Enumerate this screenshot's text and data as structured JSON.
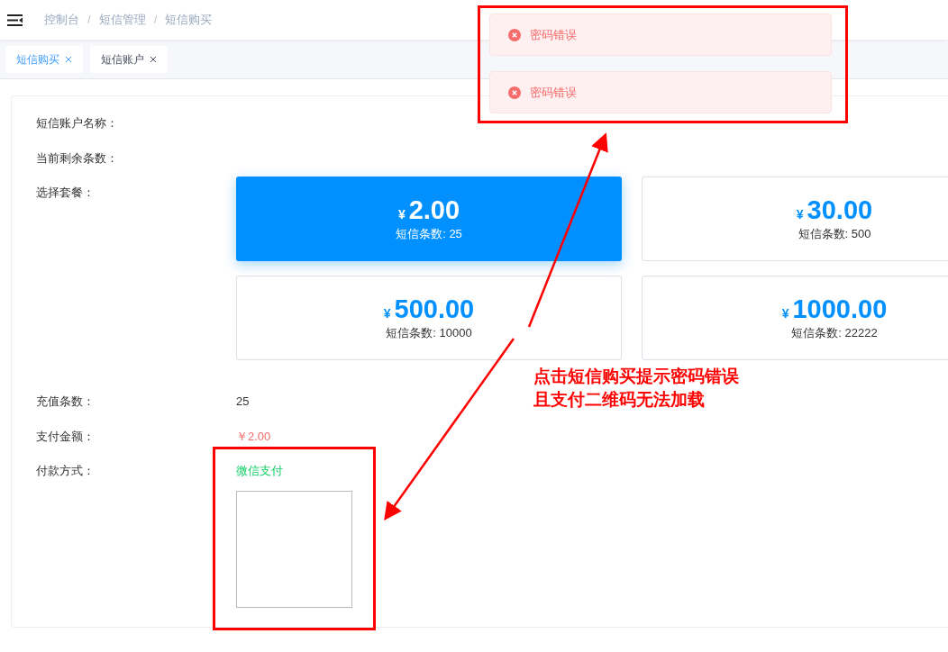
{
  "breadcrumb": [
    "控制台",
    "短信管理",
    "短信购买"
  ],
  "breadcrumb_separator": "/",
  "tabs": [
    {
      "label": "短信购买",
      "selected": true
    },
    {
      "label": "短信账户",
      "selected": false
    }
  ],
  "form": {
    "account_label": "短信账户名称：",
    "remaining_label": "当前剩余条数：",
    "package_label": "选择套餐：",
    "packages": [
      {
        "currency": "¥",
        "price": "2.00",
        "count": "短信条数: 25",
        "selected": true
      },
      {
        "currency": "¥",
        "price": "30.00",
        "count": "短信条数: 500",
        "selected": false
      },
      {
        "currency": "¥",
        "price": "500.00",
        "count": "短信条数: 10000",
        "selected": false
      },
      {
        "currency": "¥",
        "price": "1000.00",
        "count": "短信条数: 22222",
        "selected": false
      }
    ],
    "recharge_label": "充值条数：",
    "recharge_value": "25",
    "amount_label": "支付金额：",
    "amount_value": "￥2.00",
    "method_label": "付款方式：",
    "method_value": "微信支付"
  },
  "messages": [
    {
      "kind": "error",
      "text": "密码错误"
    },
    {
      "kind": "error",
      "text": "密码错误"
    }
  ],
  "annotation": {
    "lines": [
      "点击短信购买提示密码错误",
      "且支付二维码无法加载"
    ]
  }
}
